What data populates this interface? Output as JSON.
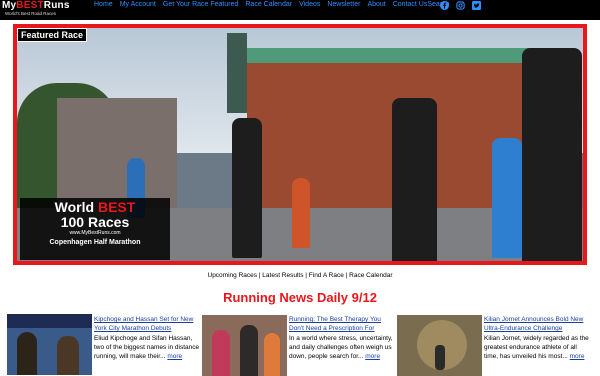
{
  "logo": {
    "part1": "My",
    "part2": "BEST",
    "part3": "Runs",
    "tagline": "World's Best Road Races"
  },
  "nav": [
    "Home",
    "My Account",
    "Get Your Race Featured",
    "Race Calendar",
    "Videos",
    "Newsletter",
    "About",
    "Contact Us",
    "Search"
  ],
  "social": [
    "facebook-icon",
    "instagram-icon",
    "twitter-icon"
  ],
  "hero": {
    "tag": "Featured Race",
    "badge_line1": "World ",
    "badge_best": "BEST",
    "badge_line2": "100 Races",
    "badge_url": "www.MyBestRuns.com",
    "badge_race": "Copenhagen Half Marathon"
  },
  "quick_links": "Upcoming Races | Latest Results | Find A Race | Race Calendar",
  "section_title": "Running News Daily 9/12",
  "articles": [
    {
      "title": "Kipchoge and Hassan Set for New York City Marathon Debuts",
      "body": "Eliud Kipchoge and Sifan Hassan, two of the biggest names in distance running, will make their...",
      "more": "more"
    },
    {
      "title": "Running: The Best Therapy You Don't Need a Prescription For",
      "body": "In a world where stress, uncertainty, and daily challenges often weigh us down, people search for...",
      "more": "more"
    },
    {
      "title": "Kilian Jornet Announces Bold New Ultra-Endurance Challenge",
      "body": "Kilian Jornet, widely regarded as the greatest endurance athlete of all time, has unveiled his most...",
      "more": "more"
    }
  ],
  "colors": {
    "brand_red": "#e8171b",
    "nav_blue": "#2f8fff",
    "link_blue": "#1a3fa0"
  }
}
